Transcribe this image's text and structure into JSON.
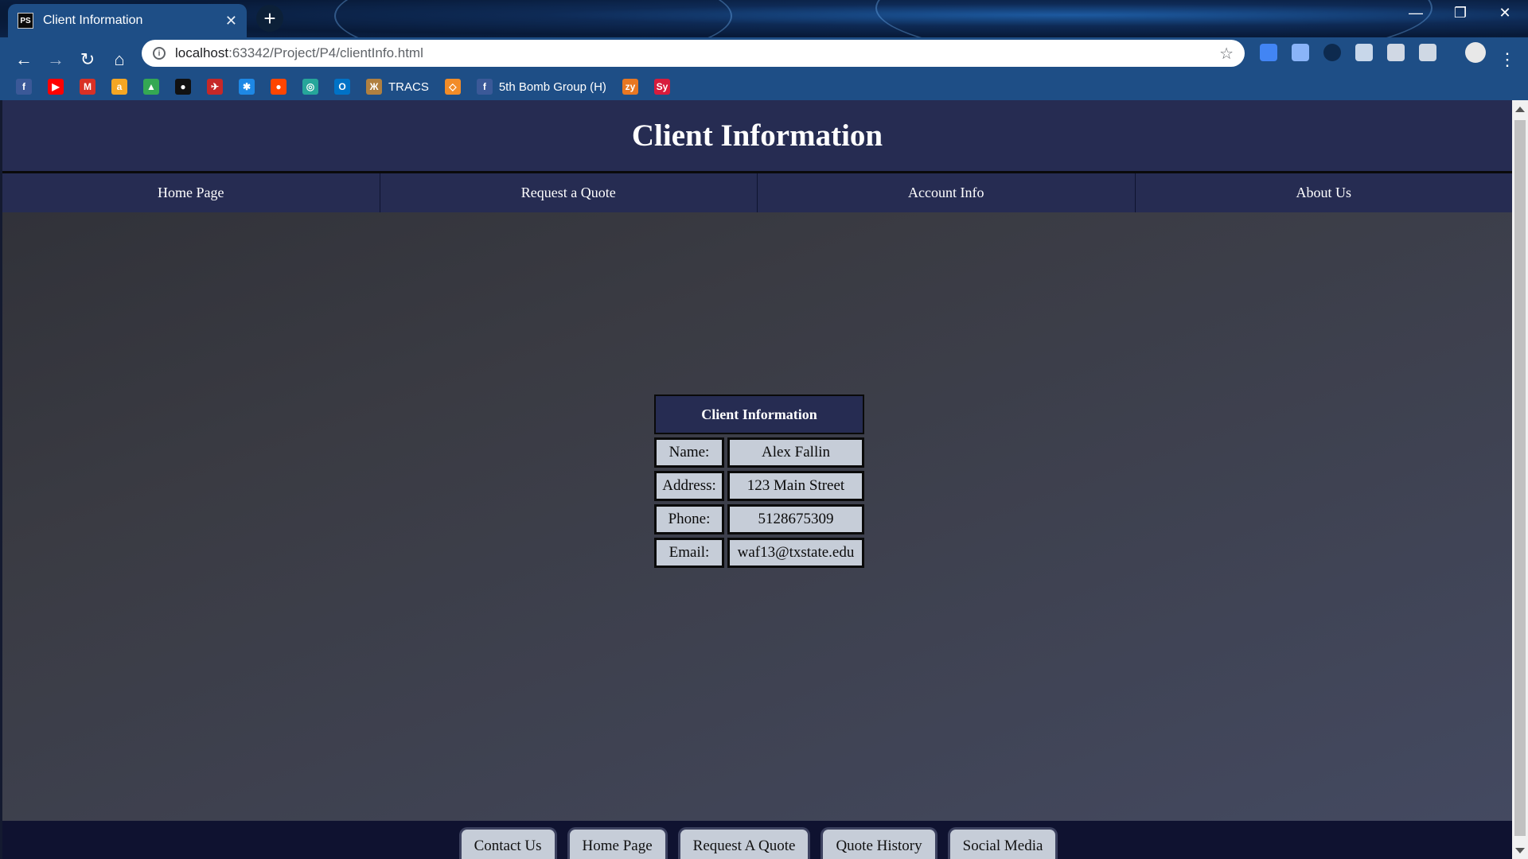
{
  "browser": {
    "tab_title": "Client Information",
    "tab_icon_text": "PS",
    "url_host": "localhost",
    "url_rest": ":63342/Project/P4/clientInfo.html",
    "bookmarks": [
      {
        "icon": "facebook-icon",
        "label": "",
        "color": "#3b5998",
        "glyph": "f"
      },
      {
        "icon": "youtube-icon",
        "label": "",
        "color": "#ff0000",
        "glyph": "▶"
      },
      {
        "icon": "gmail-icon",
        "label": "",
        "color": "#d93025",
        "glyph": "M"
      },
      {
        "icon": "amazon-icon",
        "label": "",
        "color": "#f5a623",
        "glyph": "a"
      },
      {
        "icon": "drive-icon",
        "label": "",
        "color": "#34a853",
        "glyph": "▲"
      },
      {
        "icon": "github-icon",
        "label": "",
        "color": "#111111",
        "glyph": "●"
      },
      {
        "icon": "site-icon",
        "label": "",
        "color": "#c62828",
        "glyph": "✈"
      },
      {
        "icon": "star-site-icon",
        "label": "",
        "color": "#1e88e5",
        "glyph": "✱"
      },
      {
        "icon": "reddit-icon",
        "label": "",
        "color": "#ff4500",
        "glyph": "●"
      },
      {
        "icon": "globe-icon",
        "label": "",
        "color": "#26a69a",
        "glyph": "◎"
      },
      {
        "icon": "outlook-icon",
        "label": "",
        "color": "#0072c6",
        "glyph": "O"
      },
      {
        "icon": "tracs-icon",
        "label": "TRACS",
        "color": "#b08040",
        "glyph": "Ж"
      },
      {
        "icon": "diamond-icon",
        "label": "",
        "color": "#f28c28",
        "glyph": "◇"
      },
      {
        "icon": "facebook-icon",
        "label": "5th Bomb Group (H)",
        "color": "#3b5998",
        "glyph": "f"
      },
      {
        "icon": "zybooks-icon",
        "label": "",
        "color": "#e87722",
        "glyph": "zy"
      },
      {
        "icon": "sy-icon",
        "label": "",
        "color": "#d81b3c",
        "glyph": "Sy"
      }
    ]
  },
  "page": {
    "title": "Client Information",
    "nav": [
      "Home Page",
      "Request a Quote",
      "Account Info",
      "About Us"
    ],
    "table": {
      "header": "Client Information",
      "rows": [
        {
          "label": "Name:",
          "value": "Alex Fallin"
        },
        {
          "label": "Address:",
          "value": "123 Main Street"
        },
        {
          "label": "Phone:",
          "value": "5128675309"
        },
        {
          "label": "Email:",
          "value": "waf13@txstate.edu"
        }
      ]
    },
    "footer": [
      "Contact Us",
      "Home Page",
      "Request A Quote",
      "Quote History",
      "Social Media"
    ]
  }
}
